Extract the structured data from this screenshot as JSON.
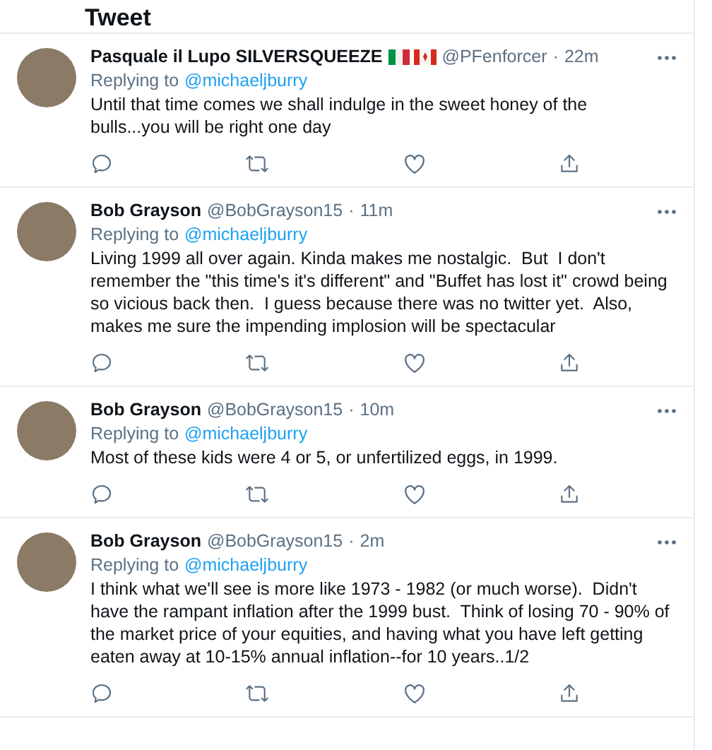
{
  "header": {
    "title": "Tweet"
  },
  "tweets": [
    {
      "name": "Pasquale il Lupo SILVERSQUEEZE",
      "flags": true,
      "handle": "@PFenforcer",
      "separator": "·",
      "time": "22m",
      "replying_label": "Replying to",
      "replying_to": "@michaeljburry",
      "text": "Until that time comes we shall indulge in the sweet honey of the bulls...you will be right one day"
    },
    {
      "name": "Bob Grayson",
      "flags": false,
      "handle": "@BobGrayson15",
      "separator": "·",
      "time": "11m",
      "replying_label": "Replying to",
      "replying_to": "@michaeljburry",
      "text": "Living 1999 all over again. Kinda makes me nostalgic.  But  I don't remember the \"this time's it's different\" and \"Buffet has lost it\" crowd being so vicious back then.  I guess because there was no twitter yet.  Also, makes me sure the impending implosion will be spectacular"
    },
    {
      "name": "Bob Grayson",
      "flags": false,
      "handle": "@BobGrayson15",
      "separator": "·",
      "time": "10m",
      "replying_label": "Replying to",
      "replying_to": "@michaeljburry",
      "text": "Most of these kids were 4 or 5, or unfertilized eggs, in 1999."
    },
    {
      "name": "Bob Grayson",
      "flags": false,
      "handle": "@BobGrayson15",
      "separator": "·",
      "time": "2m",
      "replying_label": "Replying to",
      "replying_to": "@michaeljburry",
      "text": "I think what we'll see is more like 1973 - 1982 (or much worse).  Didn't have the rampant inflation after the 1999 bust.  Think of losing 70 - 90% of the market price of your equities, and having what you have left getting eaten away at 10-15% annual inflation--for 10 years..1/2"
    }
  ]
}
